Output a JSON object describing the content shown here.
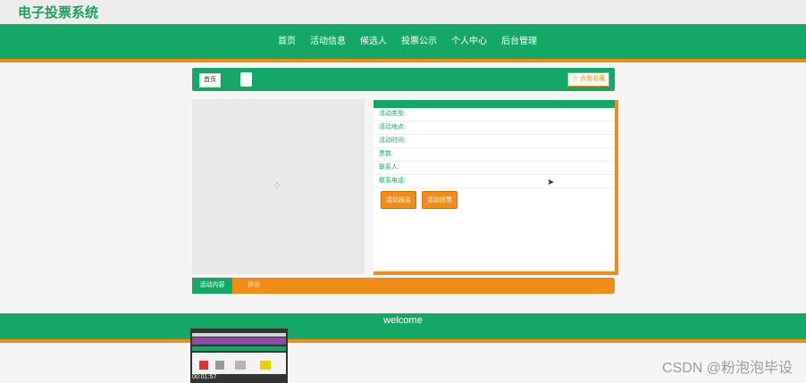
{
  "site_title": "电子投票系统",
  "nav": [
    "首页",
    "活动信息",
    "候选人",
    "投票公示",
    "个人中心",
    "后台管理"
  ],
  "breadcrumb": {
    "home": "首页",
    "favorite": "☆ 点我收藏"
  },
  "details": {
    "rows": [
      "活动类型:",
      "活动地点:",
      "活动时间:",
      "票数:",
      "联系人:",
      "联系电话:"
    ],
    "buttons": [
      "活动报名",
      "活动投票"
    ]
  },
  "tabs": [
    "活动内容",
    "评论"
  ],
  "footer": {
    "welcome": "welcome"
  },
  "thumb": {
    "timestamp": "00:01:57"
  },
  "watermark": "CSDN @粉泡泡毕设",
  "colors": {
    "green": "#15a766",
    "orange": "#f28c18"
  },
  "icons": {
    "cursor": "mouse-cursor-icon",
    "spinner": "loading-spinner-icon"
  }
}
